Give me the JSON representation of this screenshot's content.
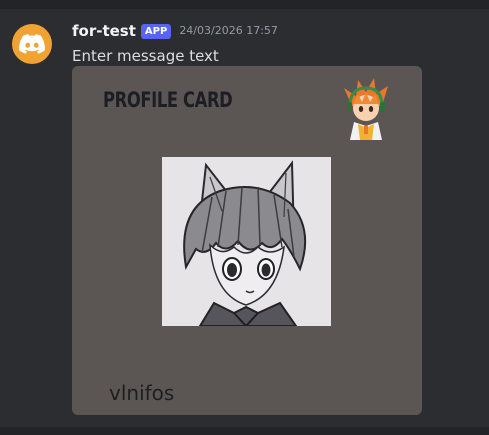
{
  "message": {
    "author": "for-test",
    "badge": "APP",
    "timestamp": "24/03/2026 17:57",
    "text": "Enter message text",
    "avatar_icon": "discord-logo-icon",
    "avatar_color": "#f0a232"
  },
  "card": {
    "title": "PROFILE CARD",
    "name": "vlnifos",
    "thumbnail_icon": "anime-character-thumbnail",
    "portrait_icon": "sketched-cat-eared-character-portrait",
    "background_color": "#5b5654"
  },
  "colors": {
    "app_background": "#2b2d31",
    "badge": "#5865f2",
    "username": "#f2f3f5",
    "timestamp": "#949ba4"
  }
}
